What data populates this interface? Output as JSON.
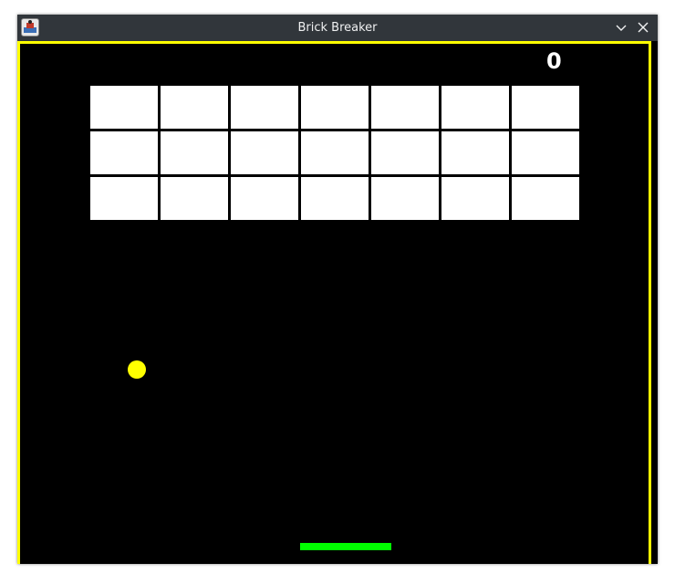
{
  "window": {
    "title": "Brick Breaker",
    "icons": {
      "app": "brick-breaker-app-icon",
      "minimize": "chevron-down-icon",
      "close": "close-icon"
    }
  },
  "game": {
    "score": "0",
    "colors": {
      "background": "#000000",
      "walls": "#ffff00",
      "bricks": "#ffffff",
      "ball": "#ffff00",
      "paddle": "#00ff00"
    },
    "bricks": {
      "rows": 3,
      "cols": 7
    }
  }
}
